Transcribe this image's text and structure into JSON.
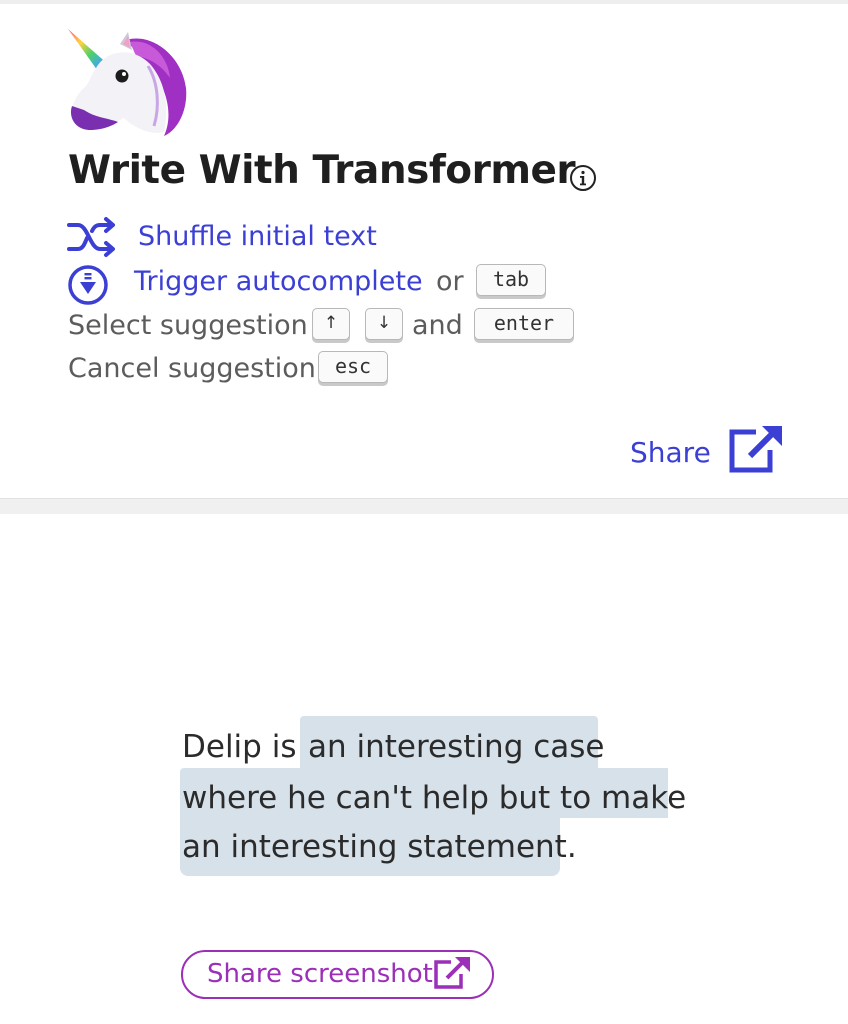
{
  "app": {
    "title": "Write With Transformer"
  },
  "instructions": {
    "shuffle_label": "Shuffle initial text",
    "trigger_label": "Trigger autocomplete",
    "or_text": "or",
    "tab_key": "tab",
    "select_label": "Select suggestion",
    "up_key": "↑",
    "down_key": "↓",
    "and_text": "and",
    "enter_key": "enter",
    "cancel_label": "Cancel suggestion",
    "esc_key": "esc"
  },
  "header": {
    "share_label": "Share"
  },
  "editor": {
    "prompt": "Delip is",
    "completion_line1": "an interesting case",
    "completion_line2": "where he can't help but to make",
    "completion_line3": "an interesting statement."
  },
  "footer": {
    "share_screenshot_label": "Share screenshot"
  },
  "colors": {
    "link": "#3b3fd4",
    "highlight": "#d6e1ea",
    "share_screenshot": "#9c2fb8"
  },
  "icons": [
    "unicorn-logo-icon",
    "info-icon",
    "shuffle-icon",
    "download-circle-icon",
    "external-link-icon"
  ]
}
